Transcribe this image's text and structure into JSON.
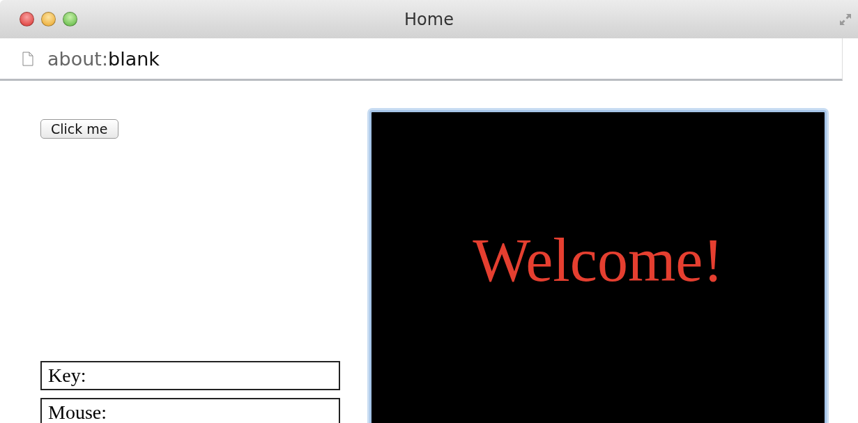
{
  "window": {
    "title": "Home"
  },
  "address_bar": {
    "scheme": "about:",
    "path": "blank"
  },
  "button": {
    "label": "Click me"
  },
  "readouts": [
    {
      "label": "Key:"
    },
    {
      "label": "Mouse:"
    }
  ],
  "canvas": {
    "focused": true,
    "text": "Welcome!"
  }
}
